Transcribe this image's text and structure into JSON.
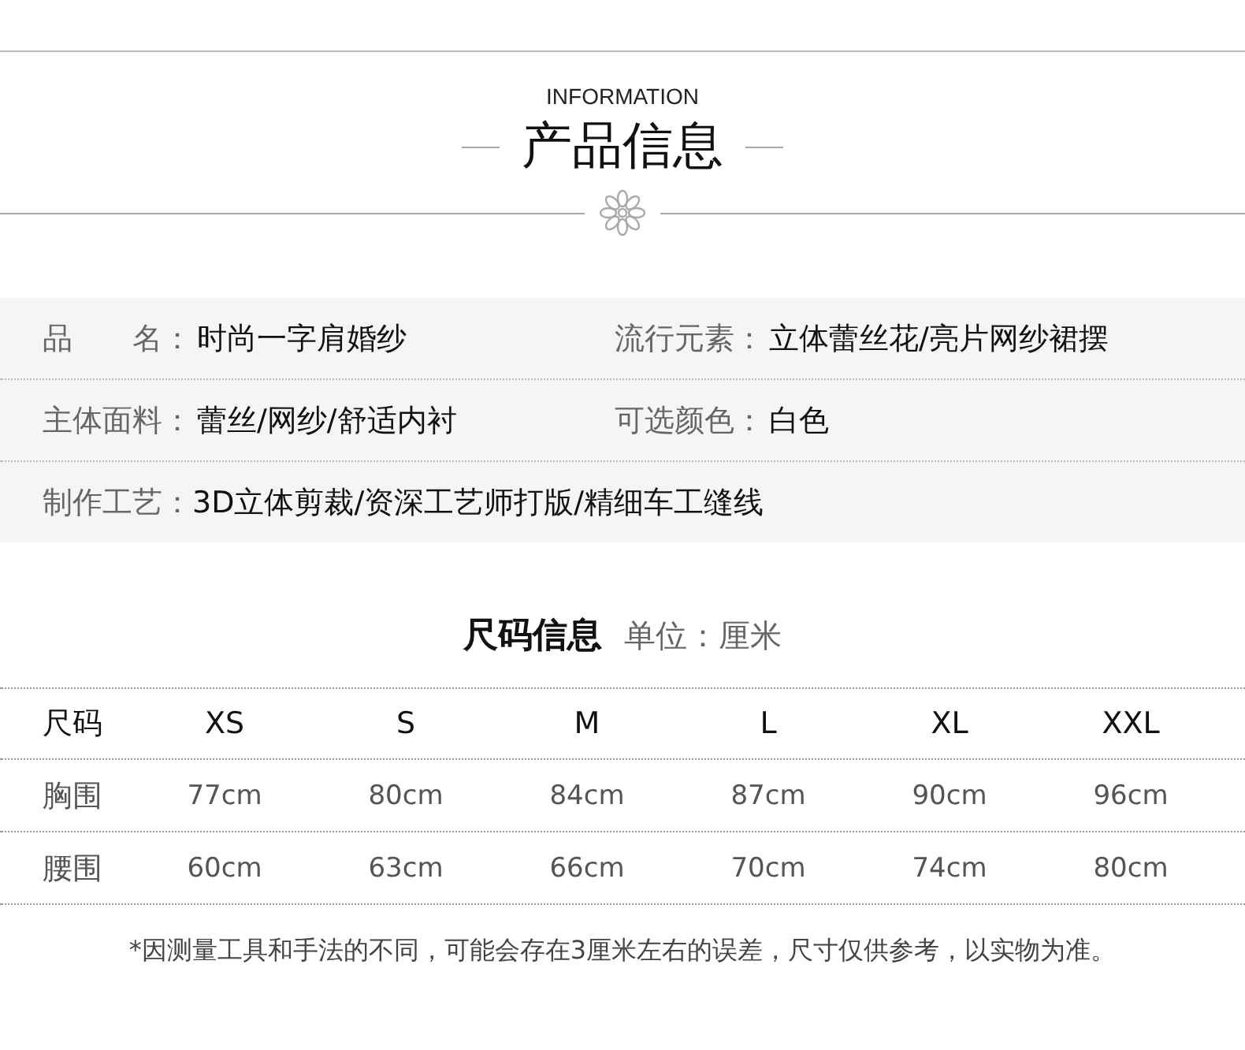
{
  "header": {
    "subtitle": "INFORMATION",
    "title": "产品信息"
  },
  "product_info": [
    [
      {
        "label": "品　　名：",
        "value": "时尚一字肩婚纱"
      },
      {
        "label": "流行元素：",
        "value": "立体蕾丝花/亮片网纱裙摆"
      }
    ],
    [
      {
        "label": "主体面料：",
        "value": "蕾丝/网纱/舒适内衬"
      },
      {
        "label": "可选颜色：",
        "value": "白色"
      }
    ],
    [
      {
        "label": "制作工艺：",
        "value": "3D立体剪裁/资深工艺师打版/精细车工缝线"
      }
    ]
  ],
  "size_section": {
    "title": "尺码信息",
    "unit": "单位：厘米"
  },
  "size_table": {
    "columns": [
      "尺码",
      "XS",
      "S",
      "M",
      "L",
      "XL",
      "XXL"
    ],
    "rows": [
      [
        "胸围",
        "77cm",
        "80cm",
        "84cm",
        "87cm",
        "90cm",
        "96cm"
      ],
      [
        "腰围",
        "60cm",
        "63cm",
        "66cm",
        "70cm",
        "74cm",
        "80cm"
      ]
    ]
  },
  "footnote": "*因测量工具和手法的不同，可能会存在3厘米左右的误差，尺寸仅供参考，以实物为准。"
}
